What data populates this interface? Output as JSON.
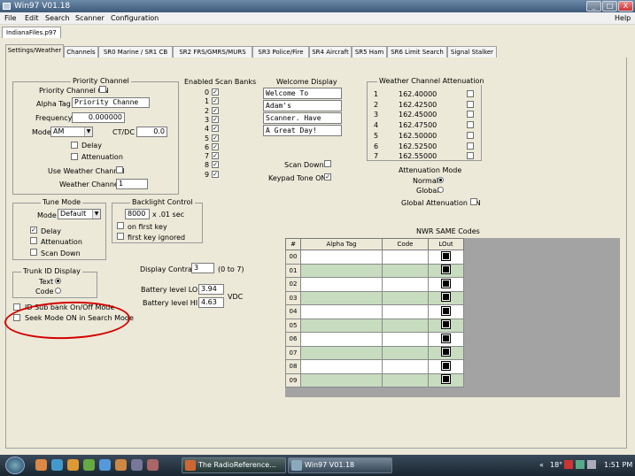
{
  "window": {
    "title": "Win97 V01.18",
    "controls": [
      "_",
      "□",
      "X"
    ]
  },
  "menu": [
    "File",
    "Edit",
    "Search",
    "Scanner",
    "Configuration"
  ],
  "help": "Help",
  "file_tab": "IndianaFiles.p97",
  "tabs": [
    "Settings/Weather",
    "Channels",
    "SR0 Marine / SR1 CB",
    "SR2 FRS/GMRS/MURS",
    "SR3 Police/Fire",
    "SR4 Aircraft",
    "SR5 Ham",
    "SR6 Limit Search",
    "Signal Stalker"
  ],
  "priority": {
    "title": "Priority Channel",
    "on_label": "Priority Channel ON",
    "alpha_label": "Alpha Tag",
    "alpha_value": "Priority Channe",
    "freq_label": "Frequency",
    "freq_value": "0.000000",
    "mode_label": "Mode",
    "mode_value": "AM",
    "ctdc_label": "CT/DC",
    "ctdc_value": "0.0",
    "delay": "Delay",
    "attenuation": "Attenuation",
    "use_weather": "Use Weather Channel",
    "weather_label": "Weather Channel",
    "weather_value": "1"
  },
  "scan_banks": {
    "title": "Enabled Scan Banks",
    "banks": [
      "0",
      "1",
      "2",
      "3",
      "4",
      "5",
      "6",
      "7",
      "8",
      "9"
    ],
    "check": "✓"
  },
  "welcome": {
    "title": "Welcome Display",
    "lines": [
      "Welcome To",
      "Adam's",
      "Scanner. Have",
      "A Great Day!"
    ]
  },
  "weather": {
    "title": "Weather Channel Attenuation",
    "channels": [
      {
        "n": "1",
        "f": "162.40000"
      },
      {
        "n": "2",
        "f": "162.42500"
      },
      {
        "n": "3",
        "f": "162.45000"
      },
      {
        "n": "4",
        "f": "162.47500"
      },
      {
        "n": "5",
        "f": "162.50000"
      },
      {
        "n": "6",
        "f": "162.52500"
      },
      {
        "n": "7",
        "f": "162.55000"
      }
    ]
  },
  "scan_down": "Scan Down",
  "keypad_tone": "Keypad Tone ON",
  "att_mode": {
    "title": "Attenuation Mode",
    "normal": "Normal",
    "global": "Global",
    "global_on": "Global Attenuation ON"
  },
  "tune": {
    "title": "Tune Mode",
    "mode_label": "Mode",
    "mode_value": "Default",
    "delay": "Delay",
    "attenuation": "Attenuation",
    "scan_down": "Scan Down"
  },
  "backlight": {
    "title": "Backlight Control",
    "value": "8000",
    "unit": "x .01 sec",
    "on_first": "on first key",
    "first_ignored": "first key ignored"
  },
  "trunk": {
    "title": "Trunk ID Display",
    "text": "Text",
    "code": "Code"
  },
  "id_sub": "ID Sub bank On/Off Mode",
  "seek": "Seek Mode ON in Search Mode",
  "contrast": {
    "label": "Display Contrast",
    "value": "3",
    "range": "(0 to 7)"
  },
  "battery": {
    "lo_label": "Battery level LO",
    "lo_value": "3.94",
    "hi_label": "Battery level HI",
    "hi_value": "4.63",
    "unit": "VDC"
  },
  "nwr": {
    "title": "NWR SAME Codes",
    "headers": [
      "#",
      "Alpha Tag",
      "Code",
      "LOut"
    ],
    "rows": [
      "00",
      "01",
      "02",
      "03",
      "04",
      "05",
      "06",
      "07",
      "08",
      "09"
    ]
  },
  "taskbar": {
    "task1": "The RadioReference...",
    "task2": "Win97 V01.18",
    "temp": "18°",
    "time": "1:51 PM"
  }
}
